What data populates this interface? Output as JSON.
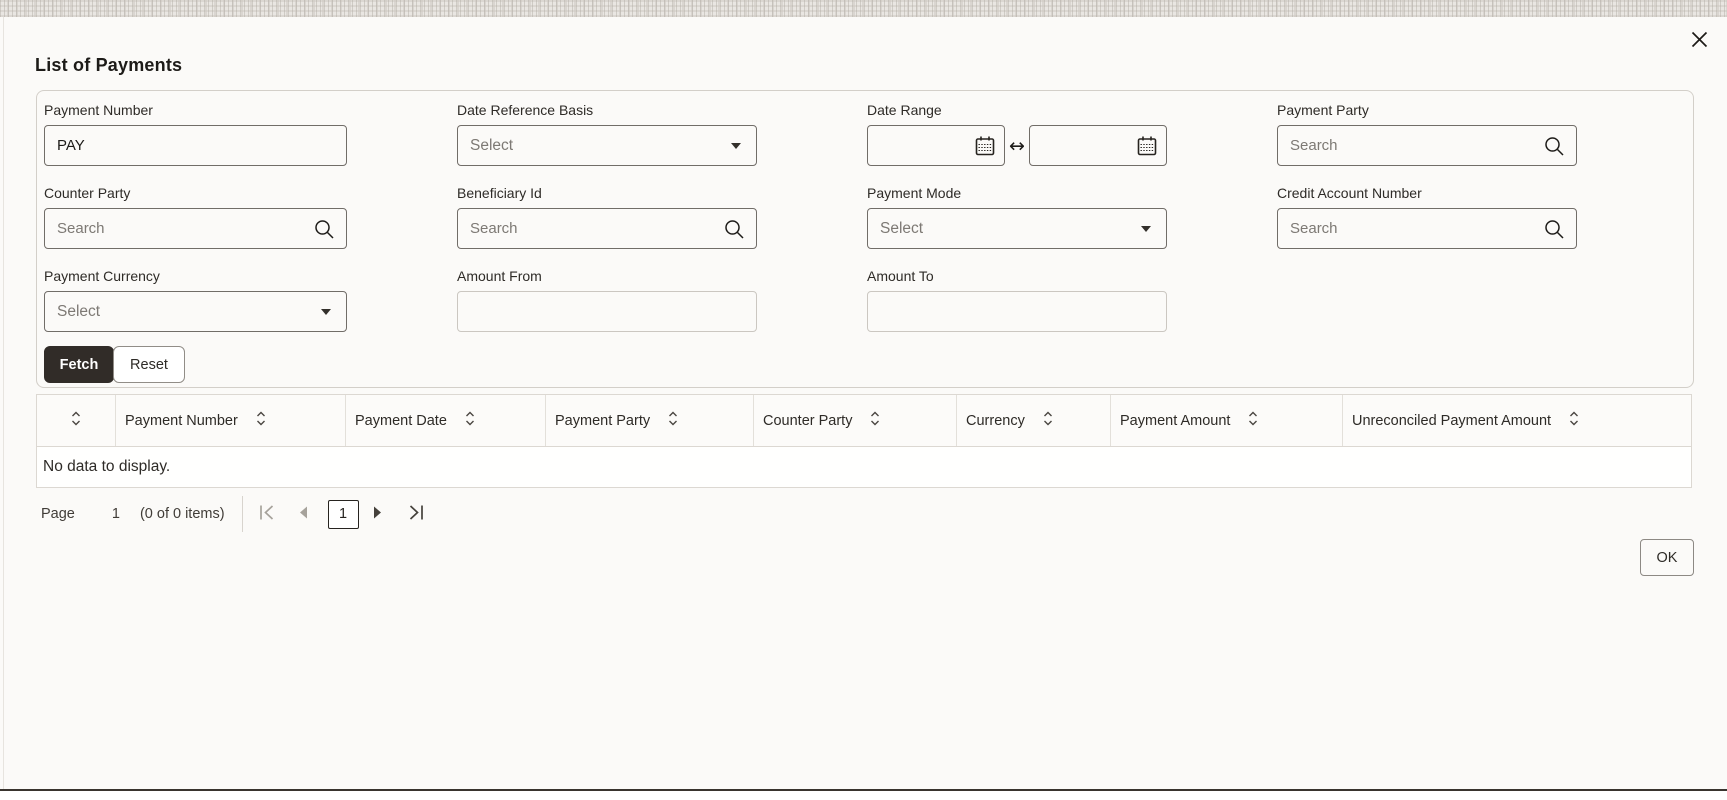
{
  "modal": {
    "title": "List of Payments"
  },
  "filters": {
    "fetch_label": "Fetch",
    "reset_label": "Reset",
    "fields": [
      {
        "id": "payment_number",
        "label": "Payment Number",
        "type": "text",
        "value": "PAY"
      },
      {
        "id": "date_reference_basis",
        "label": "Date Reference Basis",
        "type": "select",
        "placeholder": "Select"
      },
      {
        "id": "date_range",
        "label": "Date Range",
        "type": "daterange",
        "from_value": "",
        "to_value": ""
      },
      {
        "id": "payment_party",
        "label": "Payment Party",
        "type": "search",
        "placeholder": "Search"
      },
      {
        "id": "counter_party",
        "label": "Counter Party",
        "type": "search",
        "placeholder": "Search"
      },
      {
        "id": "beneficiary_id",
        "label": "Beneficiary Id",
        "type": "search",
        "placeholder": "Search"
      },
      {
        "id": "payment_mode",
        "label": "Payment Mode",
        "type": "select",
        "placeholder": "Select"
      },
      {
        "id": "credit_account_number",
        "label": "Credit Account Number",
        "type": "search",
        "placeholder": "Search"
      },
      {
        "id": "payment_currency",
        "label": "Payment Currency",
        "type": "select",
        "placeholder": "Select"
      },
      {
        "id": "amount_from",
        "label": "Amount From",
        "type": "text",
        "value": ""
      },
      {
        "id": "amount_to",
        "label": "Amount To",
        "type": "text",
        "value": ""
      }
    ]
  },
  "table": {
    "columns": [
      "",
      "Payment Number",
      "Payment Date",
      "Payment Party",
      "Counter Party",
      "Currency",
      "Payment Amount",
      "Unreconciled Payment Amount"
    ],
    "empty_message": "No data to display."
  },
  "pagination": {
    "page_label": "Page",
    "page_value": "1",
    "items_summary": "(0 of 0 items)",
    "selected_page": "1"
  },
  "footer": {
    "ok_label": "OK"
  },
  "colors": {
    "surface": "#fbfaf8",
    "primary_button_bg": "#312c28",
    "input_border": "#716d68",
    "table_border": "#dcd8d2"
  }
}
